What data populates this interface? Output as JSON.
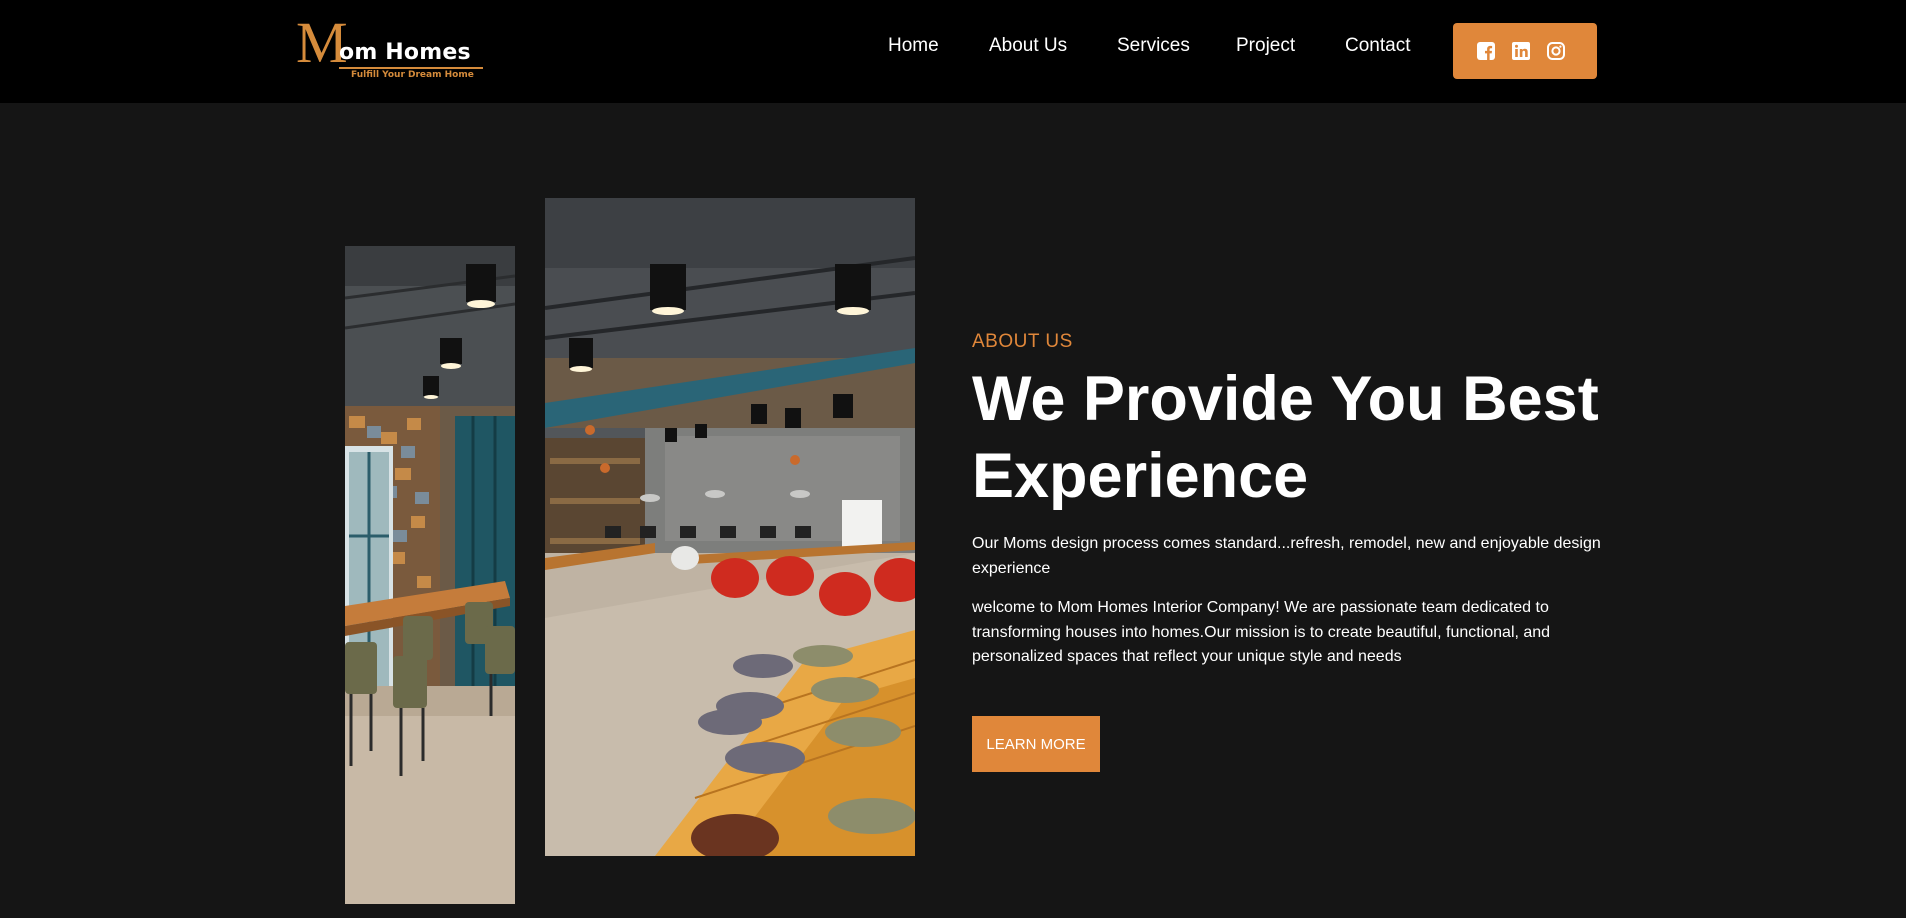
{
  "header": {
    "logo": {
      "letter": "M",
      "brand": "om Homes",
      "tagline": "Fulfill Your Dream Home"
    },
    "nav": [
      {
        "label": "Home"
      },
      {
        "label": "About Us"
      },
      {
        "label": "Services"
      },
      {
        "label": "Project"
      },
      {
        "label": "Contact"
      }
    ],
    "social": [
      {
        "icon": "facebook-icon"
      },
      {
        "icon": "linkedin-icon"
      },
      {
        "icon": "instagram-icon"
      }
    ]
  },
  "about": {
    "eyebrow": "ABOUT US",
    "headline": "We Provide You Best Experience",
    "paragraph_1": "Our Moms design process comes standard...refresh, remodel, new and enjoyable design experience",
    "paragraph_2": "welcome to Mom Homes Interior Company! We are passionate team dedicated to transforming houses into homes.Our mission is to create beautiful, functional, and personalized spaces that reflect your unique style and needs",
    "cta_label": "LEARN MORE"
  },
  "colors": {
    "accent": "#e0873a",
    "header_bg": "#000000",
    "page_bg": "#151515",
    "text": "#ffffff"
  }
}
